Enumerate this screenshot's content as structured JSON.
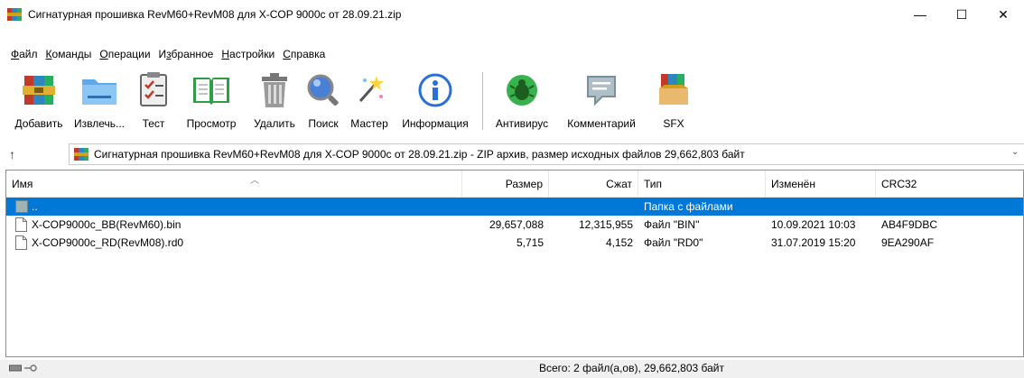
{
  "window": {
    "title": "Сигнатурная прошивка RevM60+RevM08 для X-COP 9000c от 28.09.21.zip",
    "minimize": "—",
    "maximize": "☐",
    "close": "✕"
  },
  "menu": {
    "items": [
      {
        "u": "Ф",
        "rest": "айл"
      },
      {
        "u": "К",
        "rest": "оманды"
      },
      {
        "u": "О",
        "rest": "перации"
      },
      {
        "pre": "И",
        "u": "з",
        "rest": "бранное"
      },
      {
        "u": "Н",
        "rest": "астройки"
      },
      {
        "u": "С",
        "rest": "правка"
      }
    ]
  },
  "toolbar": {
    "add": "Добавить",
    "extract": "Извлечь...",
    "test": "Тест",
    "view": "Просмотр",
    "delete": "Удалить",
    "find": "Поиск",
    "wizard": "Мастер",
    "info": "Информация",
    "antivirus": "Антивирус",
    "comment": "Комментарий",
    "sfx": "SFX"
  },
  "address": {
    "up": "↑",
    "text": "Сигнатурная прошивка RevM60+RevM08 для X-COP 9000c от 28.09.21.zip - ZIP архив, размер исходных файлов 29,662,803 байт",
    "dropdown": "⌄"
  },
  "columns": {
    "name": "Имя",
    "size": "Размер",
    "packed": "Сжат",
    "type": "Тип",
    "modified": "Изменён",
    "crc": "CRC32"
  },
  "rows": [
    {
      "name": "..",
      "size": "",
      "packed": "",
      "type": "Папка с файлами",
      "modified": "",
      "crc": ""
    },
    {
      "name": "X-COP9000c_BB(RevM60).bin",
      "size": "29,657,088",
      "packed": "12,315,955",
      "type": "Файл \"BIN\"",
      "modified": "10.09.2021 10:03",
      "crc": "AB4F9DBC"
    },
    {
      "name": "X-COP9000c_RD(RevM08).rd0",
      "size": "5,715",
      "packed": "4,152",
      "type": "Файл \"RD0\"",
      "modified": "31.07.2019 15:20",
      "crc": "9EA290AF"
    }
  ],
  "status": {
    "total": "Всего: 2 файл(а,ов), 29,662,803 байт"
  },
  "colors": {
    "selection": "#0078d7",
    "status_bg": "#f0f0f0"
  }
}
